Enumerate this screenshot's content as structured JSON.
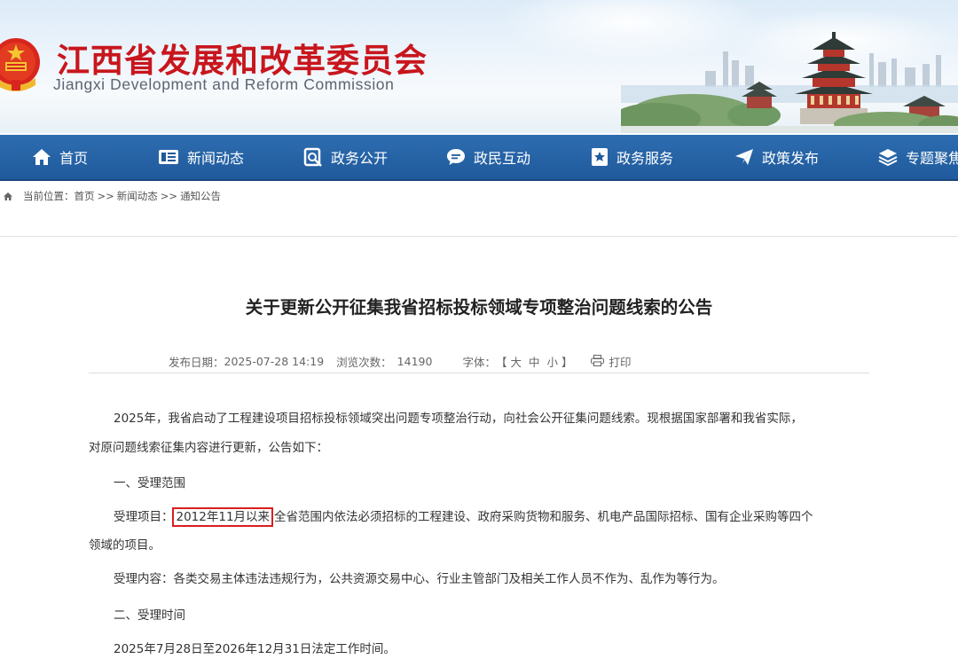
{
  "site": {
    "title": "江西省发展和改革委员会",
    "subtitle": "Jiangxi Development and Reform Commission"
  },
  "nav": {
    "items": [
      {
        "label": "首页",
        "icon": "home-icon"
      },
      {
        "label": "新闻动态",
        "icon": "news-icon"
      },
      {
        "label": "政务公开",
        "icon": "document-search-icon"
      },
      {
        "label": "政民互动",
        "icon": "chat-icon"
      },
      {
        "label": "政务服务",
        "icon": "bookmark-star-icon"
      },
      {
        "label": "政策发布",
        "icon": "send-icon"
      },
      {
        "label": "专题聚焦",
        "icon": "layers-icon"
      }
    ]
  },
  "breadcrumb": {
    "prefix": "当前位置：",
    "items": [
      "首页",
      "新闻动态",
      "通知公告"
    ],
    "separator": ">>"
  },
  "article": {
    "title": "关于更新公开征集我省招标投标领域专项整治问题线索的公告",
    "meta": {
      "date_label": "发布日期：",
      "date": "2025-07-28 14:19",
      "views_label": "浏览次数：",
      "views": "14190",
      "font_label": "字体：",
      "bracket_open": "【",
      "size_large": "大",
      "size_medium": "中",
      "size_small": "小",
      "bracket_close": "】",
      "print": "打印"
    },
    "intro_line1": "2025年，我省启动了工程建设项目招标投标领域突出问题专项整治行动，向社会公开征集问题线索。现根据国家部署和我省实际，",
    "intro_line2": "对原问题线索征集内容进行更新，公告如下：",
    "section1_heading": "一、受理范围",
    "scope_label": "受理项目：",
    "scope_highlight": "2012年11月以来",
    "scope_rest": "全省范围内依法必须招标的工程建设、政府采购货物和服务、机电产品国际招标、国有企业采购等四个",
    "scope_line2": "领域的项目。",
    "content_label": "受理内容：",
    "content_text": "各类交易主体违法违规行为，公共资源交易中心、行业主管部门及相关工作人员不作为、乱作为等行为。",
    "section2_heading": "二、受理时间",
    "time_text": "2025年7月28日至2026年12月31日法定工作时间。"
  },
  "colors": {
    "title_red": "#c8161d",
    "nav_blue": "#1f5a9c",
    "highlight_box": "#d91e1e"
  }
}
